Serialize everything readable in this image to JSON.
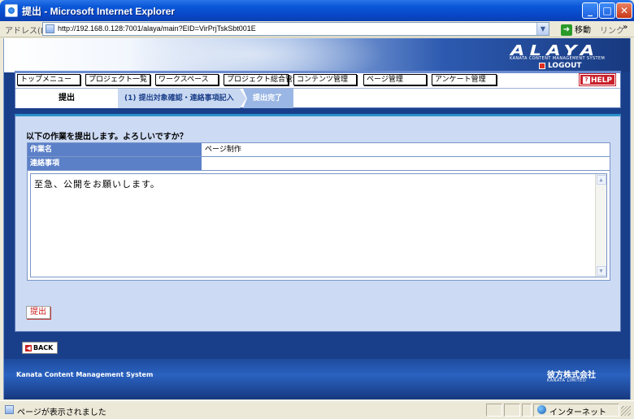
{
  "window": {
    "title": "提出 - Microsoft Internet Explorer"
  },
  "addressbar": {
    "label": "アドレス(D)",
    "url": "http://192.168.0.128:7001/alaya/main?EID=VirPrjTskSbt001E",
    "go_label": "移動",
    "links_label": "リンク",
    "more": "»"
  },
  "header": {
    "logo": "ALAYA",
    "logo_sub": "KANATA CONTENT MANAGEMENT SYSTEM",
    "logout_label": "LOGOUT"
  },
  "nav": {
    "menu": [
      "トップメニュー",
      "プロジェクト一覧",
      "ワークスペース",
      "プロジェクト総合管理",
      "コンテンツ管理",
      "ページ管理",
      "アンケート管理"
    ],
    "help_label": "HELP"
  },
  "steps": {
    "current": "提出",
    "step1": "(1) 提出対象確認・連絡事項記入",
    "step2": "提出完了"
  },
  "form": {
    "prompt": "以下の作業を提出します。よろしいですか？",
    "task_name_label": "作業名",
    "task_name_value": "ページ制作",
    "notes_label": "連絡事項",
    "notes_value": "至急、公開をお願いします。",
    "submit_label": "提出"
  },
  "back_label": "BACK",
  "footer": {
    "system_name": "Kanata Content Management System",
    "company": "彼方株式会社",
    "company_sub": "KANATA LIMITED"
  },
  "statusbar": {
    "text": "ページが表示されました",
    "zone": "インターネット"
  },
  "colors": {
    "accent": "#1a3f8a",
    "panel": "#ccdaf4",
    "label_bg": "#5c80c8",
    "help_red": "#c8202a"
  }
}
